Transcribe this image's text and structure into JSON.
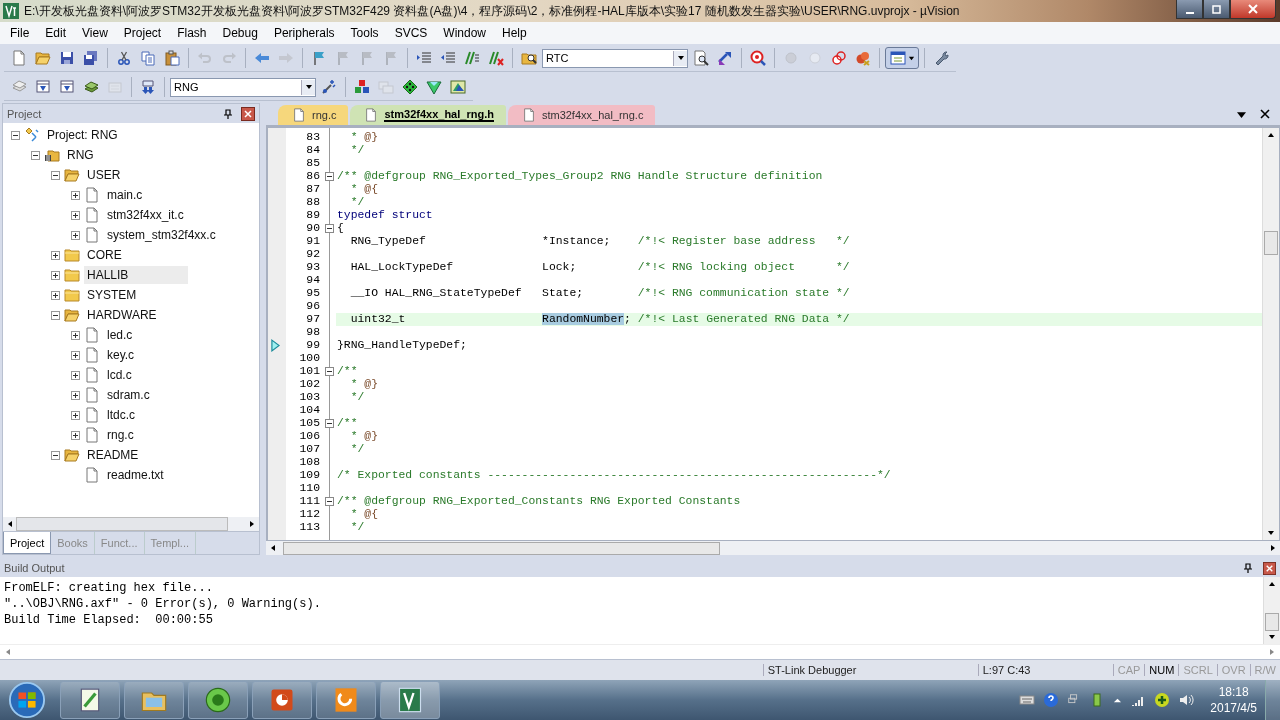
{
  "window": {
    "title": "E:\\开发板光盘资料\\阿波罗STM32开发板光盘资料\\阿波罗STM32F429 资料盘(A盘)\\4，程序源码\\2，标准例程-HAL库版本\\实验17 随机数发生器实验\\USER\\RNG.uvprojx - µVision"
  },
  "menu": [
    "File",
    "Edit",
    "View",
    "Project",
    "Flash",
    "Debug",
    "Peripherals",
    "Tools",
    "SVCS",
    "Window",
    "Help"
  ],
  "toolbar_1": {
    "buttons": [
      {
        "disabled": false
      },
      {
        "disabled": false
      },
      {
        "disabled": false
      },
      {
        "disabled": false
      },
      {
        "disabled": false
      },
      {
        "disabled": false
      },
      {
        "disabled": false
      },
      {
        "disabled": true
      },
      {
        "disabled": true
      },
      {
        "disabled": false
      },
      {
        "disabled": true
      },
      {
        "disabled": false
      },
      {
        "disabled": true
      },
      {
        "disabled": true
      },
      {
        "disabled": true
      },
      {
        "disabled": false
      },
      {
        "disabled": false
      },
      {
        "disabled": false
      },
      {
        "disabled": false
      },
      {
        "disabled": false
      },
      {
        "disabled": false
      },
      {
        "disabled": false
      },
      {
        "disabled": false
      },
      {
        "disabled": true
      },
      {
        "disabled": true
      },
      {
        "disabled": false
      },
      {
        "disabled": false
      },
      {
        "disabled": false
      },
      {
        "disabled": false
      }
    ],
    "find_combo": {
      "value": "RTC"
    }
  },
  "toolbar_2": {
    "buttons": [
      {
        "disabled": false
      },
      {
        "disabled": false
      },
      {
        "disabled": false
      },
      {
        "disabled": false
      },
      {
        "disabled": true
      },
      {
        "disabled": false
      },
      {
        "disabled": false
      },
      {
        "disabled": false
      },
      {
        "disabled": true
      },
      {
        "disabled": false
      },
      {
        "disabled": false
      },
      {
        "disabled": false
      }
    ],
    "target_combo": {
      "value": "RNG"
    }
  },
  "project_panel": {
    "title": "Project",
    "tree": [
      {
        "label": "Project: RNG",
        "kind": "project",
        "expanded": true,
        "selected": false,
        "children": [
          {
            "label": "RNG",
            "kind": "target",
            "expanded": true,
            "selected": false,
            "children": [
              {
                "label": "USER",
                "kind": "group",
                "expanded": true,
                "selected": false,
                "children": [
                  {
                    "label": "main.c",
                    "kind": "file",
                    "selected": false
                  },
                  {
                    "label": "stm32f4xx_it.c",
                    "kind": "file",
                    "selected": false
                  },
                  {
                    "label": "system_stm32f4xx.c",
                    "kind": "file",
                    "selected": false
                  }
                ]
              },
              {
                "label": "CORE",
                "kind": "group",
                "expanded": false,
                "selected": false
              },
              {
                "label": "HALLIB",
                "kind": "group",
                "expanded": false,
                "selected": true
              },
              {
                "label": "SYSTEM",
                "kind": "group",
                "expanded": false,
                "selected": false
              },
              {
                "label": "HARDWARE",
                "kind": "group",
                "expanded": true,
                "selected": false,
                "children": [
                  {
                    "label": "led.c",
                    "kind": "file",
                    "selected": false
                  },
                  {
                    "label": "key.c",
                    "kind": "file",
                    "selected": false
                  },
                  {
                    "label": "lcd.c",
                    "kind": "file",
                    "selected": false
                  },
                  {
                    "label": "sdram.c",
                    "kind": "file",
                    "selected": false
                  },
                  {
                    "label": "ltdc.c",
                    "kind": "file",
                    "selected": false
                  },
                  {
                    "label": "rng.c",
                    "kind": "file",
                    "selected": false
                  }
                ]
              },
              {
                "label": "README",
                "kind": "group",
                "expanded": true,
                "selected": false,
                "children": [
                  {
                    "label": "readme.txt",
                    "kind": "leaf",
                    "selected": false
                  }
                ]
              }
            ]
          }
        ]
      }
    ],
    "tabs": [
      {
        "label": "Project",
        "selected": true
      },
      {
        "label": "Books",
        "selected": false
      },
      {
        "label": "Funct...",
        "selected": false
      },
      {
        "label": "Templ...",
        "selected": false
      }
    ]
  },
  "editor": {
    "tabs": [
      {
        "label": "rng.c",
        "selected": false,
        "color": "#f6d77c"
      },
      {
        "label": "stm32f4xx_hal_rng.h",
        "selected": true,
        "color": "#cfe3b4"
      },
      {
        "label": "stm32f4xx_hal_rng.c",
        "selected": false,
        "color": "#f2bcc4"
      }
    ],
    "lines": [
      {
        "n": "83",
        "fold_box": false,
        "highlighted": false,
        "arrow": false,
        "segs": [
          {
            "kind": "comment",
            "t": "  * "
          },
          {
            "kind": "tag",
            "t": "@}"
          }
        ]
      },
      {
        "n": "84",
        "fold_box": false,
        "highlighted": false,
        "arrow": false,
        "segs": [
          {
            "kind": "comment",
            "t": "  */"
          }
        ]
      },
      {
        "n": "85",
        "fold_box": false,
        "highlighted": false,
        "arrow": false
      },
      {
        "n": "86",
        "fold_box": true,
        "highlighted": false,
        "arrow": false,
        "segs": [
          {
            "kind": "comment",
            "t": "/** @defgroup RNG_Exported_Types_Group2 RNG Handle Structure definition"
          }
        ]
      },
      {
        "n": "87",
        "fold_box": false,
        "highlighted": false,
        "arrow": false,
        "segs": [
          {
            "kind": "comment",
            "t": "  * "
          },
          {
            "kind": "tag",
            "t": "@{"
          }
        ]
      },
      {
        "n": "88",
        "fold_box": false,
        "highlighted": false,
        "arrow": false,
        "segs": [
          {
            "kind": "comment",
            "t": "  */"
          }
        ]
      },
      {
        "n": "89",
        "fold_box": false,
        "highlighted": false,
        "arrow": false,
        "segs": [
          {
            "kind": "keyword",
            "t": "typedef struct"
          }
        ]
      },
      {
        "n": "90",
        "fold_box": true,
        "highlighted": false,
        "arrow": false,
        "segs": [
          {
            "kind": "plain",
            "t": "{"
          }
        ]
      },
      {
        "n": "91",
        "fold_box": false,
        "highlighted": false,
        "arrow": false,
        "segs": [
          {
            "kind": "plain",
            "t": "  RNG_TypeDef                 *Instance;    "
          },
          {
            "kind": "comment",
            "t": "/*!< Register base address   */"
          }
        ]
      },
      {
        "n": "92",
        "fold_box": false,
        "highlighted": false,
        "arrow": false
      },
      {
        "n": "93",
        "fold_box": false,
        "highlighted": false,
        "arrow": false,
        "segs": [
          {
            "kind": "plain",
            "t": "  HAL_LockTypeDef             Lock;         "
          },
          {
            "kind": "comment",
            "t": "/*!< RNG locking object      */"
          }
        ]
      },
      {
        "n": "94",
        "fold_box": false,
        "highlighted": false,
        "arrow": false
      },
      {
        "n": "95",
        "fold_box": false,
        "highlighted": false,
        "arrow": false,
        "segs": [
          {
            "kind": "plain",
            "t": "  __IO HAL_RNG_StateTypeDef   State;        "
          },
          {
            "kind": "comment",
            "t": "/*!< RNG communication state */"
          }
        ]
      },
      {
        "n": "96",
        "fold_box": false,
        "highlighted": false,
        "arrow": false
      },
      {
        "n": "97",
        "fold_box": false,
        "highlighted": true,
        "arrow": false,
        "segs": [
          {
            "kind": "plain",
            "t": "  uint32_t                    "
          },
          {
            "kind": "selected",
            "t": "RandomNumber"
          },
          {
            "kind": "plain",
            "t": "; "
          },
          {
            "kind": "comment",
            "t": "/*!< Last Generated RNG Data */"
          }
        ]
      },
      {
        "n": "98",
        "fold_box": false,
        "highlighted": false,
        "arrow": false
      },
      {
        "n": "99",
        "fold_box": false,
        "highlighted": false,
        "arrow": true,
        "segs": [
          {
            "kind": "plain",
            "t": "}RNG_HandleTypeDef;"
          }
        ]
      },
      {
        "n": "100",
        "fold_box": false,
        "highlighted": false,
        "arrow": false
      },
      {
        "n": "101",
        "fold_box": true,
        "highlighted": false,
        "arrow": false,
        "segs": [
          {
            "kind": "comment",
            "t": "/**"
          }
        ]
      },
      {
        "n": "102",
        "fold_box": false,
        "highlighted": false,
        "arrow": false,
        "segs": [
          {
            "kind": "comment",
            "t": "  * "
          },
          {
            "kind": "tag",
            "t": "@}"
          }
        ]
      },
      {
        "n": "103",
        "fold_box": false,
        "highlighted": false,
        "arrow": false,
        "segs": [
          {
            "kind": "comment",
            "t": "  */"
          }
        ]
      },
      {
        "n": "104",
        "fold_box": false,
        "highlighted": false,
        "arrow": false
      },
      {
        "n": "105",
        "fold_box": true,
        "highlighted": false,
        "arrow": false,
        "segs": [
          {
            "kind": "comment",
            "t": "/**"
          }
        ]
      },
      {
        "n": "106",
        "fold_box": false,
        "highlighted": false,
        "arrow": false,
        "segs": [
          {
            "kind": "comment",
            "t": "  * "
          },
          {
            "kind": "tag",
            "t": "@}"
          }
        ]
      },
      {
        "n": "107",
        "fold_box": false,
        "highlighted": false,
        "arrow": false,
        "segs": [
          {
            "kind": "comment",
            "t": "  */"
          }
        ]
      },
      {
        "n": "108",
        "fold_box": false,
        "highlighted": false,
        "arrow": false
      },
      {
        "n": "109",
        "fold_box": false,
        "highlighted": false,
        "arrow": false,
        "segs": [
          {
            "kind": "comment",
            "t": "/* Exported constants ---------------------------------------------------------*/"
          }
        ]
      },
      {
        "n": "110",
        "fold_box": false,
        "highlighted": false,
        "arrow": false
      },
      {
        "n": "111",
        "fold_box": true,
        "highlighted": false,
        "arrow": false,
        "segs": [
          {
            "kind": "comment",
            "t": "/** @defgroup RNG_Exported_Constants RNG Exported Constants"
          }
        ]
      },
      {
        "n": "112",
        "fold_box": false,
        "highlighted": false,
        "arrow": false,
        "segs": [
          {
            "kind": "comment",
            "t": "  * "
          },
          {
            "kind": "tag",
            "t": "@{"
          }
        ]
      },
      {
        "n": "113",
        "fold_box": false,
        "highlighted": false,
        "arrow": false,
        "segs": [
          {
            "kind": "comment",
            "t": "  */"
          }
        ]
      }
    ]
  },
  "build_output": {
    "title": "Build Output",
    "lines": [
      "FromELF: creating hex file...",
      "\"..\\OBJ\\RNG.axf\" - 0 Error(s), 0 Warning(s).",
      "Build Time Elapsed:  00:00:55"
    ]
  },
  "status_bar": {
    "debugger": "ST-Link Debugger",
    "position": "L:97 C:43",
    "indicators": [
      {
        "label": "CAP",
        "on": false
      },
      {
        "label": "NUM",
        "on": true
      },
      {
        "label": "SCRL",
        "on": false
      },
      {
        "label": "OVR",
        "on": false
      },
      {
        "label": "R/W",
        "on": false
      }
    ]
  },
  "taskbar": {
    "time": "18:18",
    "date": "2017/4/5"
  }
}
